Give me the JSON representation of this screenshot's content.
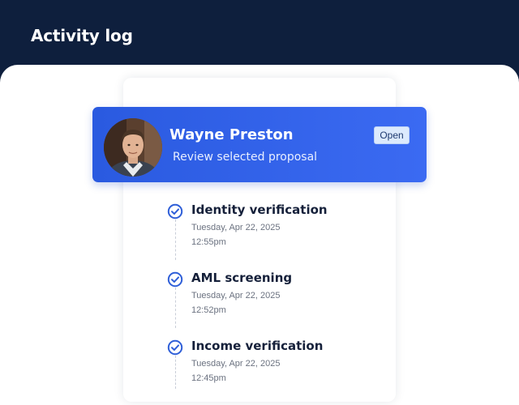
{
  "header": {
    "title": "Activity log"
  },
  "user_card": {
    "name": "Wayne Preston",
    "subtitle": "Review selected proposal",
    "badge": "Open",
    "avatar_icon": "person-photo"
  },
  "activities": [
    {
      "title": "Identity verification",
      "date": "Tuesday, Apr 22, 2025",
      "time": "12:55pm",
      "icon": "check-circle-icon"
    },
    {
      "title": "AML screening",
      "date": "Tuesday, Apr 22, 2025",
      "time": "12:52pm",
      "icon": "check-circle-icon"
    },
    {
      "title": "Income verification",
      "date": "Tuesday, Apr 22, 2025",
      "time": "12:45pm",
      "icon": "check-circle-icon"
    }
  ],
  "colors": {
    "header_bg": "#0e1f3d",
    "accent": "#2f63ea",
    "check": "#2f5fd8"
  }
}
